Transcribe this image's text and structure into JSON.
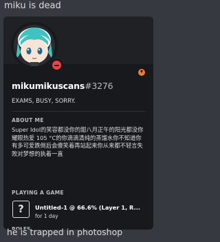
{
  "messages": {
    "top_text": "miku is dead",
    "bottom_text": "he is trapped in photoshop"
  },
  "profile": {
    "username": "mikumikuscans",
    "discriminator": "#3276",
    "custom_status": "EXAMS, BUSY, SORRY.",
    "status": "do-not-disturb",
    "about_title": "ABOUT ME",
    "about_text": "Super Idol的笑容都没你的甜八月正午的阳光都没你耀眼热爱 105 °C的你滴滴清纯的蒸馏水你不知道你有多可爱跌倒后会傻笑着再站起来你从来都不轻言失败对梦想的执着一直",
    "activity_title": "PLAYING A GAME",
    "activity_name": "Untitled-1 @ 66.6% (Layer 1, R...",
    "activity_time": "for 1 day",
    "activity_icon": "question-mark-icon",
    "activity_icon_glyph": "?",
    "roles_title": "ROLES"
  },
  "colors": {
    "background": "#36393f",
    "card": "#18191c",
    "banner": "#1f2124",
    "dnd_status": "#ed4245",
    "badge": "#f57731",
    "miku_hair": "#3fc3c0"
  }
}
